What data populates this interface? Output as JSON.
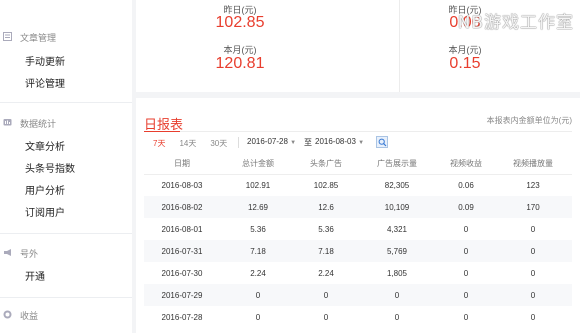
{
  "sidebar": {
    "sections": [
      {
        "title": "文章管理",
        "icon": "article-icon",
        "items": [
          "手动更新",
          "评论管理"
        ]
      },
      {
        "title": "数据统计",
        "icon": "stats-icon",
        "items": [
          "文章分析",
          "头条号指数",
          "用户分析",
          "订阅用户"
        ]
      },
      {
        "title": "号外",
        "icon": "megaphone-icon",
        "items": [
          "开通"
        ]
      },
      {
        "title": "收益",
        "icon": "coin-icon",
        "items": []
      }
    ]
  },
  "stats": {
    "left": {
      "yesterday_label": "昨日(元)",
      "yesterday_value": "102.85",
      "month_label": "本月(元)",
      "month_value": "120.81"
    },
    "right": {
      "yesterday_label": "昨日(元)",
      "yesterday_value": "0.06",
      "month_label": "本月(元)",
      "month_value": "0.15"
    }
  },
  "watermark": "NB游戏工作室",
  "report": {
    "title": "日报表",
    "note": "本报表内金额单位为(元)",
    "range_tabs": [
      "7天",
      "14天",
      "30天"
    ],
    "start_date": "2016-07-28",
    "to_label": "至",
    "end_date": "2016-08-03",
    "columns": [
      "日期",
      "总计金额",
      "头条广告",
      "广告展示量",
      "视频收益",
      "视频播放量"
    ],
    "rows": [
      [
        "2016-08-03",
        "102.91",
        "102.85",
        "82,305",
        "0.06",
        "123"
      ],
      [
        "2016-08-02",
        "12.69",
        "12.6",
        "10,109",
        "0.09",
        "170"
      ],
      [
        "2016-08-01",
        "5.36",
        "5.36",
        "4,321",
        "0",
        "0"
      ],
      [
        "2016-07-31",
        "7.18",
        "7.18",
        "5,769",
        "0",
        "0"
      ],
      [
        "2016-07-30",
        "2.24",
        "2.24",
        "1,805",
        "0",
        "0"
      ],
      [
        "2016-07-29",
        "0",
        "0",
        "0",
        "0",
        "0"
      ],
      [
        "2016-07-28",
        "0",
        "0",
        "0",
        "0",
        "0"
      ]
    ]
  },
  "colors": {
    "accent": "#e83e2e",
    "link": "#3a7bd5"
  }
}
